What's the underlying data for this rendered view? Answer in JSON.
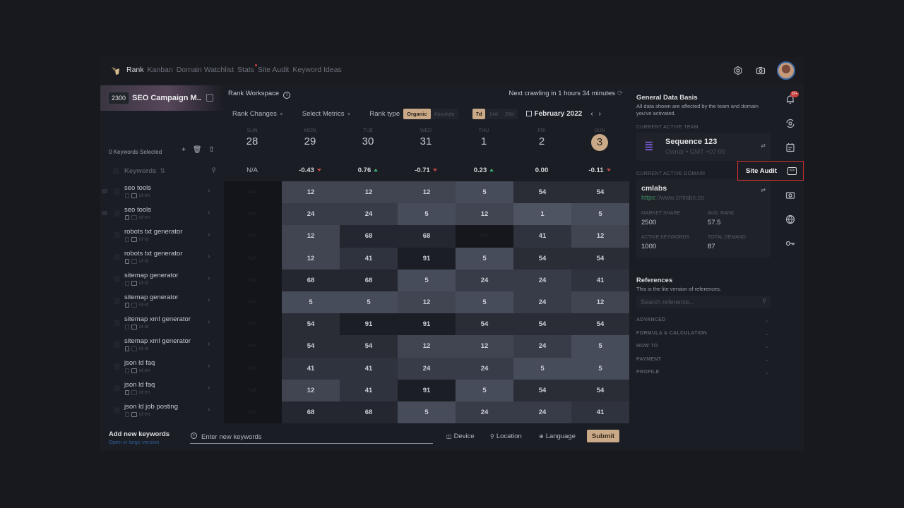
{
  "nav": {
    "items": [
      {
        "label": "Rank",
        "active": true
      },
      {
        "label": "Kanban",
        "active": false
      },
      {
        "label": "Domain Watchlist",
        "active": false
      },
      {
        "label": "Stats",
        "active": false,
        "dot": true
      },
      {
        "label": "Site Audit",
        "active": false
      },
      {
        "label": "Keyword Ideas",
        "active": false
      }
    ]
  },
  "campaign": {
    "count": "2300",
    "title": "SEO Campaign M.."
  },
  "keywords": {
    "selected_label": "0 Keywords Selected",
    "header_label": "Keywords",
    "rows": [
      {
        "name": "seo tools",
        "locale": "id-en"
      },
      {
        "name": "seo tools",
        "locale": "id-en"
      },
      {
        "name": "robots txt generator",
        "locale": "id-id"
      },
      {
        "name": "robots txt generator",
        "locale": "id-id"
      },
      {
        "name": "sitemap generator",
        "locale": "id-id"
      },
      {
        "name": "sitemap generator",
        "locale": "id-id"
      },
      {
        "name": "sitemap xml generator",
        "locale": "id-id"
      },
      {
        "name": "sitemap xml generator",
        "locale": "id-id"
      },
      {
        "name": "json ld faq",
        "locale": "id-en"
      },
      {
        "name": "json ld faq",
        "locale": "id-en"
      },
      {
        "name": "json ld job posting",
        "locale": "id-en"
      }
    ]
  },
  "workspace": {
    "title": "Rank Workspace",
    "crawl_status": "Next crawling in 1 hours 34 minutes",
    "rank_changes_label": "Rank Changes",
    "select_metrics_label": "Select Metrics",
    "rank_type_label": "Rank type",
    "rank_types": [
      {
        "label": "Organic",
        "on": true
      },
      {
        "label": "Absolute",
        "on": false
      }
    ],
    "ranges": [
      {
        "label": "7d",
        "on": true
      },
      {
        "label": "14d",
        "on": false
      },
      {
        "label": "28d",
        "on": false
      }
    ],
    "month": "February 2022",
    "days": [
      {
        "dow": "SUN",
        "num": "28",
        "change": "N/A",
        "trend": "none"
      },
      {
        "dow": "MON",
        "num": "29",
        "change": "-0.43",
        "trend": "down"
      },
      {
        "dow": "TUE",
        "num": "30",
        "change": "0.76",
        "trend": "up"
      },
      {
        "dow": "WED",
        "num": "31",
        "change": "-0.71",
        "trend": "down"
      },
      {
        "dow": "THU",
        "num": "1",
        "change": "0.23",
        "trend": "up"
      },
      {
        "dow": "FRI",
        "num": "2",
        "change": "0.00",
        "trend": "none"
      },
      {
        "dow": "SUN",
        "num": "3",
        "change": "-0.11",
        "trend": "down",
        "today": true
      }
    ],
    "na_label": "N/A",
    "grid": [
      [
        null,
        12,
        12,
        12,
        5,
        54,
        54
      ],
      [
        null,
        24,
        24,
        5,
        12,
        1,
        5
      ],
      [
        null,
        12,
        68,
        68,
        null,
        41,
        12
      ],
      [
        null,
        12,
        41,
        91,
        5,
        54,
        54
      ],
      [
        null,
        68,
        68,
        5,
        24,
        24,
        41
      ],
      [
        null,
        5,
        5,
        12,
        5,
        24,
        12
      ],
      [
        null,
        54,
        91,
        91,
        54,
        54,
        54
      ],
      [
        null,
        54,
        54,
        12,
        12,
        24,
        5
      ],
      [
        null,
        41,
        41,
        24,
        24,
        5,
        5
      ],
      [
        null,
        12,
        41,
        91,
        5,
        54,
        54
      ],
      [
        null,
        68,
        68,
        5,
        24,
        24,
        41
      ]
    ]
  },
  "panel": {
    "title": "General Data Basis",
    "subtitle": "All data shown are affected by the team and domain you've activated.",
    "team_label": "CURRENT ACTIVE TEAM",
    "team_name": "Sequence 123",
    "team_sub": "Owner • GMT +07:00",
    "domain_label": "CURRENT ACTIVE DOMAIN",
    "domain_name": "cmlabs",
    "domain_proto": "https",
    "domain_rest": "://www.cmlabs.co",
    "metrics": [
      {
        "label": "MARKET SHARE",
        "value": "2500"
      },
      {
        "label": "AVG. RANK",
        "value": "57.5"
      },
      {
        "label": "ACTIVE KEYWORDS",
        "value": "1000"
      },
      {
        "label": "TOTAL DEMAND",
        "value": "87"
      }
    ],
    "refs_title": "References",
    "refs_sub": "This is the lite version of references.",
    "refs_placeholder": "Search reference...",
    "accordions": [
      "ADVANCED",
      "FORMULA & CALCULATION",
      "HOW TO",
      "PAYMENT",
      "PROFILE"
    ]
  },
  "sidebar": {
    "notif_badge": "10+",
    "site_audit_label": "Site Audit"
  },
  "bottom": {
    "add_title": "Add new keywords",
    "add_link": "Open in large version",
    "input_placeholder": "Enter new keywords",
    "device_label": "Device",
    "location_label": "Location",
    "language_label": "Language",
    "submit_label": "Submit"
  }
}
